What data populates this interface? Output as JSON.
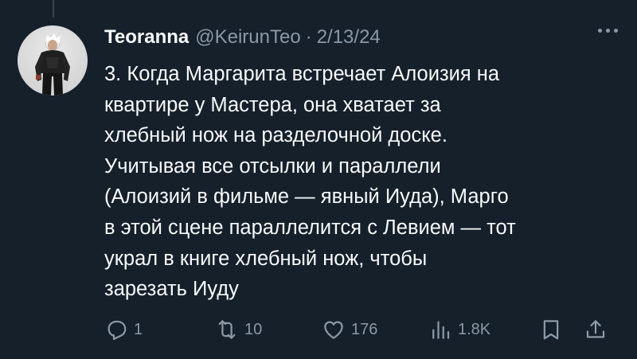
{
  "author": {
    "display_name": "Teoranna",
    "handle": "@KeirunTeo",
    "separator": "·",
    "date": "2/13/24"
  },
  "tweet": {
    "text": "3. Когда Маргарита встречает Алоизия на\nквартире у Мастера, она хватает за\nхлебный нож на разделочной доске.\nУчитывая все отсылки и параллели\n(Алоизий в фильме — явный Иуда), Марго\nв этой сцене параллелится с Левием — тот\nукрал в книге хлебный нож, чтобы\nзарезать Иуду"
  },
  "actions": {
    "replies": "1",
    "retweets": "10",
    "likes": "176",
    "views": "1.8K"
  },
  "icons": {
    "more": "more-horizontal-icon",
    "reply": "reply-icon",
    "retweet": "retweet-icon",
    "like": "heart-icon",
    "views": "views-icon",
    "bookmark": "bookmark-icon",
    "share": "share-icon"
  },
  "colors": {
    "background": "#15202b",
    "text": "#f7f9f9",
    "muted": "#8b98a5"
  }
}
